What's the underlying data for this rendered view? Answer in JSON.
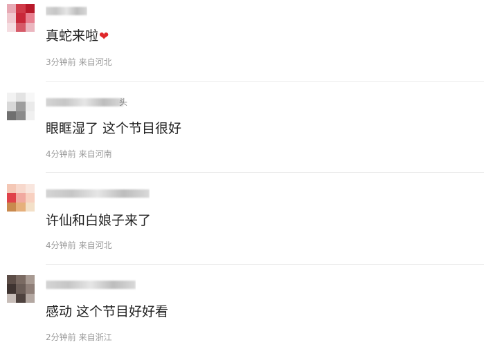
{
  "comments": [
    {
      "username_visible": "",
      "text": "真蛇来啦",
      "emoji": "heart-emoji",
      "time": "3分钟前",
      "location": "来自河北",
      "avatar_colors": [
        "#e7a9b4",
        "#d03a48",
        "#b8192a",
        "#f0c9cf",
        "#c92839",
        "#e88090",
        "#f5dde1",
        "#d65a68",
        "#ebb6bf"
      ]
    },
    {
      "username_visible": "头",
      "text": "眼眶湿了 这个节目很好",
      "time": "4分钟前",
      "location": "来自河南",
      "avatar_colors": [
        "#f2f2f2",
        "#e3e3e3",
        "#f7f7f7",
        "#d8d8d8",
        "#9e9e9e",
        "#eaeaea",
        "#6f6f6f",
        "#8a8a8a",
        "#f0f0f0"
      ]
    },
    {
      "username_visible": "",
      "text": "许仙和白娘子来了",
      "time": "4分钟前",
      "location": "来自河北",
      "avatar_colors": [
        "#f4c7b5",
        "#f7d8cc",
        "#f9e6de",
        "#e0424a",
        "#f1a9a0",
        "#f8d0c0",
        "#c98a4e",
        "#e6b07c",
        "#f3e0c8"
      ]
    },
    {
      "username_visible": "",
      "text": "感动 这个节目好好看",
      "time": "2分钟前",
      "location": "来自浙江",
      "avatar_colors": [
        "#5c4d47",
        "#7a6a62",
        "#a89a92",
        "#3f3431",
        "#6b5d57",
        "#8f7f78",
        "#c7bdb8",
        "#4e423e",
        "#b3a7a1"
      ]
    }
  ]
}
